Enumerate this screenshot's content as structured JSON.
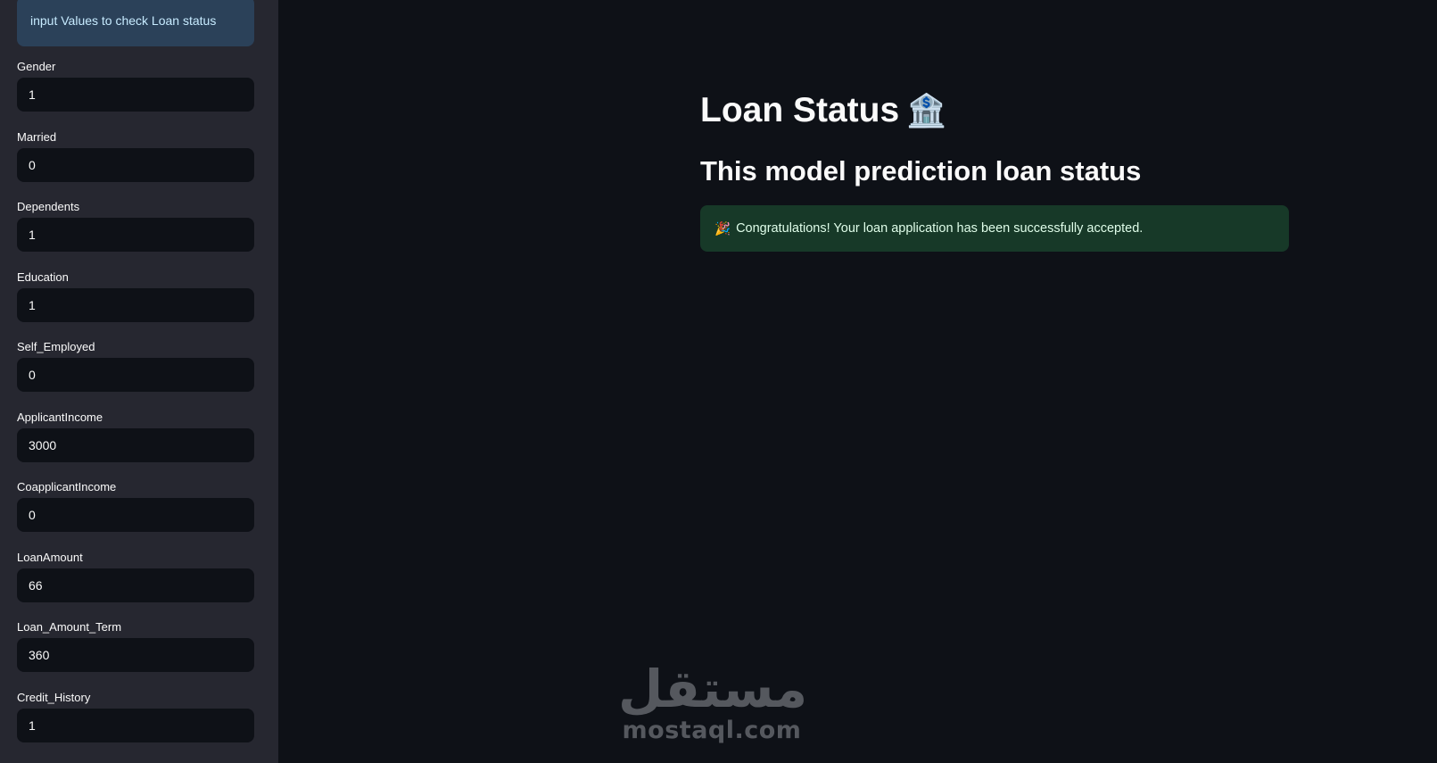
{
  "sidebar": {
    "info_text": "input Values to check Loan status",
    "fields": [
      {
        "label": "Gender",
        "value": "1"
      },
      {
        "label": "Married",
        "value": "0"
      },
      {
        "label": "Dependents",
        "value": "1"
      },
      {
        "label": "Education",
        "value": "1"
      },
      {
        "label": "Self_Employed",
        "value": "0"
      },
      {
        "label": "ApplicantIncome",
        "value": "3000"
      },
      {
        "label": "CoapplicantIncome",
        "value": "0"
      },
      {
        "label": "LoanAmount",
        "value": "66"
      },
      {
        "label": "Loan_Amount_Term",
        "value": "360"
      },
      {
        "label": "Credit_History",
        "value": "1"
      }
    ]
  },
  "main": {
    "title": "Loan Status",
    "title_emoji": "🏦",
    "subtitle": "This model prediction loan status",
    "success": {
      "emoji": "🎉",
      "message": "Congratulations! Your loan application has been successfully accepted."
    }
  },
  "watermark": {
    "arabic": "مستقل",
    "latin": "mostaql.com"
  },
  "colors": {
    "background": "#0e1117",
    "sidebar": "#262730",
    "info_box": "#2b4159",
    "success_box": "#173928",
    "text": "#fafafa"
  }
}
